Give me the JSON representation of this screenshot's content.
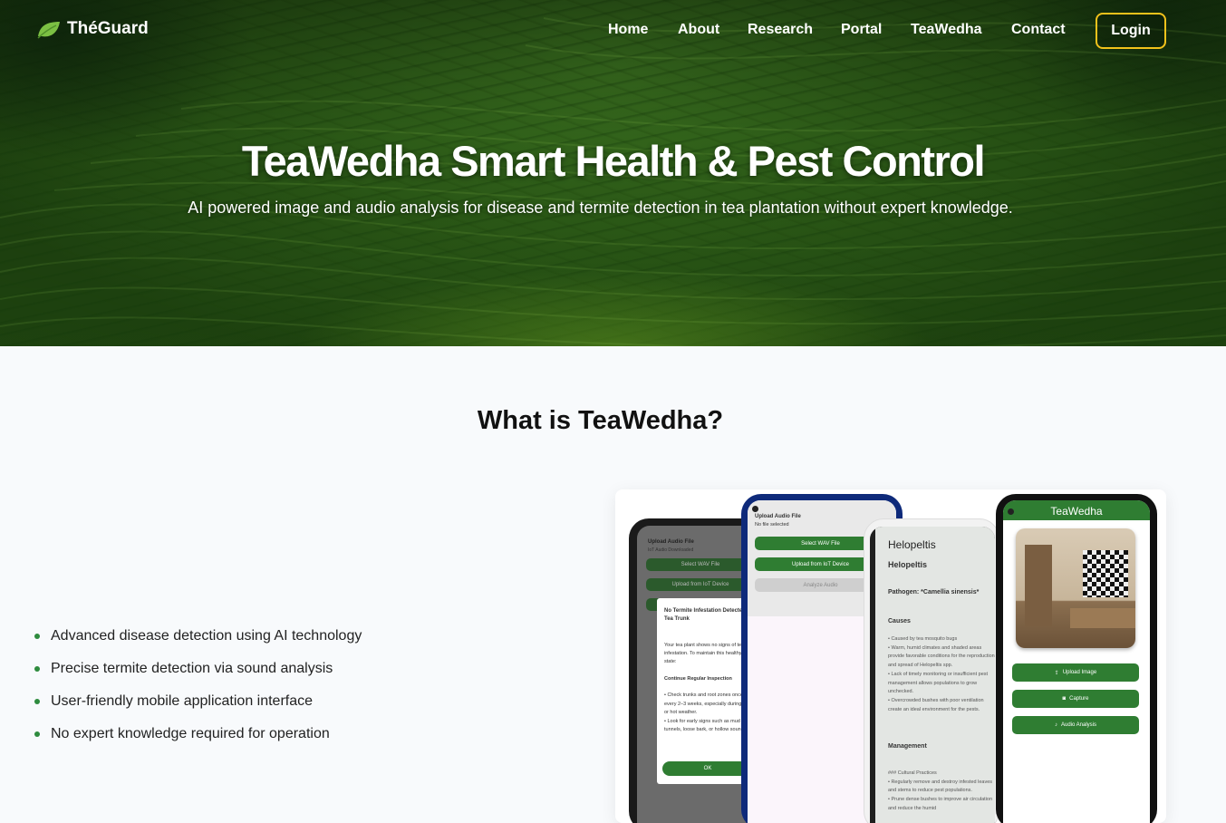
{
  "brand": {
    "name": "ThéGuard"
  },
  "nav": {
    "items": [
      "Home",
      "About",
      "Research",
      "Portal",
      "TeaWedha",
      "Contact"
    ],
    "login": "Login"
  },
  "hero": {
    "title": "TeaWedha Smart Health & Pest Control",
    "subtitle": "AI powered image and audio analysis for disease and termite detection in tea plantation without expert knowledge."
  },
  "about": {
    "title": "What is TeaWedha?",
    "features": [
      "Advanced disease detection using AI technology",
      "Precise termite detection via sound analysis",
      "User-friendly mobile application interface",
      "No expert knowledge required for operation"
    ]
  },
  "phone1": {
    "header": "Upload Audio File",
    "sub": "IoT Audio Downloaded",
    "btn1": "Select WAV File",
    "btn2": "Upload from IoT Device",
    "dialog_title": "No Termite Infestation Detected in Tea Trunk",
    "dialog_body": "Your tea plant shows no signs of termite infestation. To maintain this healthy state:",
    "dialog_section": "Continue Regular Inspection",
    "dialog_list": "• Check trunks and root zones once every 2–3 weeks, especially during dry or hot weather.\n• Look for early signs such as mud tunnels, loose bark, or hollow sounds.",
    "dialog_ok": "OK"
  },
  "phone2": {
    "header": "Upload Audio File",
    "sub": "No file selected",
    "btn1": "Select WAV File",
    "btn2": "Upload from IoT Device",
    "btn3": "Analyze Audio"
  },
  "phone3": {
    "title": "Helopeltis",
    "heading": "Helopeltis",
    "pathogen": "Pathogen: *Camellia sinensis*",
    "causes_h": "Causes",
    "causes": "• Caused by tea mosquito bugs\n• Warm, humid climates and shaded areas provide favorable conditions for the reproduction and spread of Helopeltis spp.\n• Lack of timely monitoring or insufficient pest management allows populations to grow unchecked.\n• Overcrowded bushes with poor ventilation create an ideal environment for the pests.",
    "management_h": "Management",
    "management": "### Cultural Practices\n• Regularly remove and destroy infested leaves and stems to reduce pest populations.\n• Prune dense bushes to improve air circulation and reduce the humid"
  },
  "phone4": {
    "appbar": "TeaWedha",
    "btn1": "Upload Image",
    "btn2": "Capture",
    "btn3": "Audio Analysis"
  }
}
